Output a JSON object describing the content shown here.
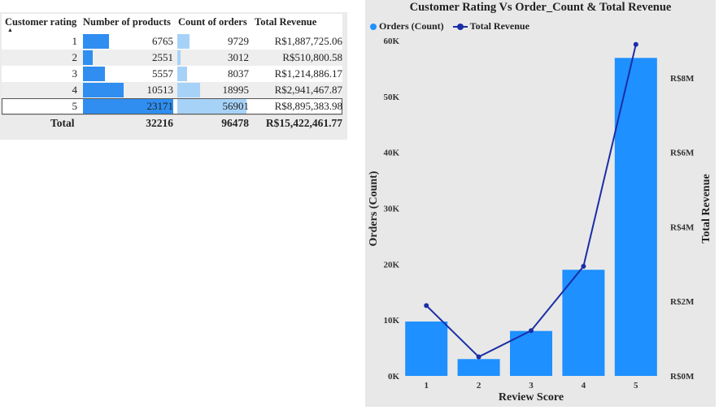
{
  "table": {
    "headers": {
      "rating": "Customer rating",
      "products": "Number of products",
      "orders": "Count of orders",
      "revenue": "Total Revenue"
    },
    "sort_indicator": "▲",
    "rows": [
      {
        "rating": "1",
        "products": "6765",
        "orders": "9729",
        "revenue": "R$1,887,725.06"
      },
      {
        "rating": "2",
        "products": "2551",
        "orders": "3012",
        "revenue": "R$510,800.58"
      },
      {
        "rating": "3",
        "products": "5557",
        "orders": "8037",
        "revenue": "R$1,214,886.17"
      },
      {
        "rating": "4",
        "products": "10513",
        "orders": "18995",
        "revenue": "R$2,941,467.87"
      },
      {
        "rating": "5",
        "products": "23171",
        "orders": "56901",
        "revenue": "R$8,895,383.98"
      }
    ],
    "total": {
      "label": "Total",
      "products": "32216",
      "orders": "96478",
      "revenue": "R$15,422,461.77"
    },
    "bar_max": {
      "products": 23171,
      "orders": 56901
    },
    "colors": {
      "products_bar": "#2f8ef0",
      "orders_bar": "#a7d2f7"
    }
  },
  "chart_data": {
    "type": "bar",
    "title": "Customer Rating Vs Order_Count & Total Revenue",
    "xlabel": "Review Score",
    "ylabel": "Orders (Count)",
    "y2label": "Total Revenue",
    "categories": [
      "1",
      "2",
      "3",
      "4",
      "5"
    ],
    "series": [
      {
        "name": "Orders (Count)",
        "kind": "bar",
        "axis": "left",
        "color": "#1e90ff",
        "values": [
          9729,
          3012,
          8037,
          18995,
          56901
        ]
      },
      {
        "name": "Total Revenue",
        "kind": "line",
        "axis": "right",
        "color": "#1a2ea6",
        "values": [
          1887725.06,
          510800.58,
          1214886.17,
          2941467.87,
          8895383.98
        ]
      }
    ],
    "ylim": [
      0,
      60000
    ],
    "y_ticks": [
      0,
      10000,
      20000,
      30000,
      40000,
      50000,
      60000
    ],
    "y_tick_labels": [
      "0K",
      "10K",
      "20K",
      "30K",
      "40K",
      "50K",
      "60K"
    ],
    "y2lim": [
      0,
      9000000
    ],
    "y2_ticks": [
      0,
      2000000,
      4000000,
      6000000,
      8000000
    ],
    "y2_tick_labels": [
      "R$0M",
      "R$2M",
      "R$4M",
      "R$6M",
      "R$8M"
    ],
    "legend_position": "top-left",
    "grid": false
  }
}
